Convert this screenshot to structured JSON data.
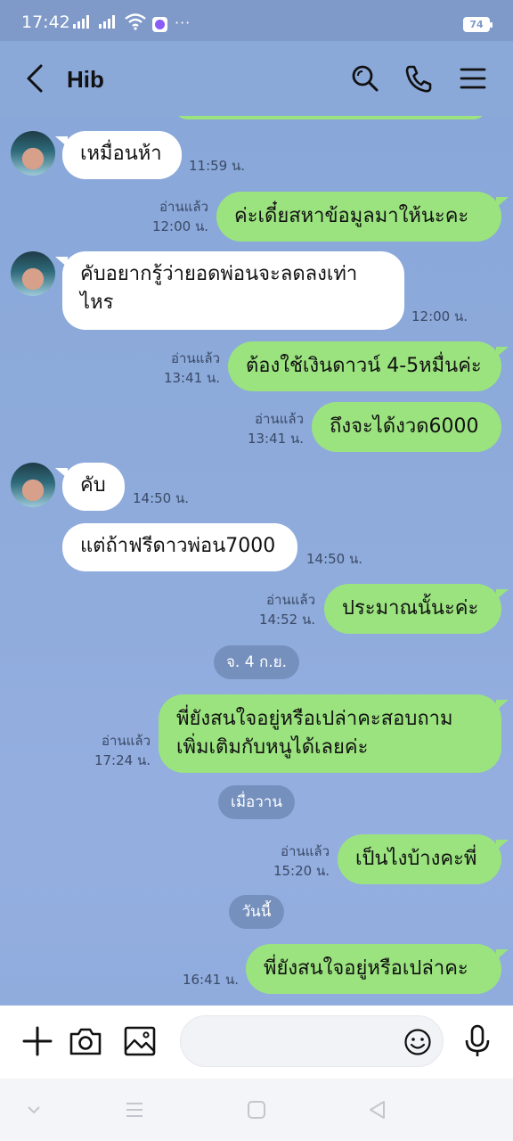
{
  "status": {
    "time": "17:42",
    "more": "···",
    "battery": "74"
  },
  "header": {
    "title": "Hib"
  },
  "messages": {
    "m1": {
      "text": "เหมื่อนห้า",
      "time": "11:59 น."
    },
    "m2": {
      "text": "ค่ะเดี๋ยสหาข้อมูลมาให้นะคะ",
      "read": "อ่านแล้ว",
      "time": "12:00 น."
    },
    "m3": {
      "line1": "คับอยากรู้ว่ายอดพ่อนจะลดลงเท่า",
      "line2": "ไหร",
      "time": "12:00 น."
    },
    "m4": {
      "text": "ต้องใช้เงินดาวน์ 4-5หมื่นค่ะ",
      "read": "อ่านแล้ว",
      "time": "13:41 น."
    },
    "m5": {
      "text": "ถึงจะได้งวด6000",
      "read": "อ่านแล้ว",
      "time": "13:41 น."
    },
    "m6": {
      "text": "คับ",
      "time": "14:50 น."
    },
    "m7": {
      "text": "แต่ถ้าฟรีดาวพ่อน7000",
      "time": "14:50 น."
    },
    "m8": {
      "text": "ประมาณนั้นะค่ะ",
      "read": "อ่านแล้ว",
      "time": "14:52 น."
    },
    "m9": {
      "line1": "พี่ยังสนใจอยู่หรือเปล่าคะสอบถาม",
      "line2": "เพิ่มเติมกับหนูได้เลยค่ะ",
      "read": "อ่านแล้ว",
      "time": "17:24 น."
    },
    "m10": {
      "text": "เป็นไงบ้างคะพี่",
      "read": "อ่านแล้ว",
      "time": "15:20 น."
    },
    "m11": {
      "text": "พี่ยังสนใจอยู่หรือเปล่าคะ",
      "time": "16:41 น."
    }
  },
  "dates": {
    "d1": "จ. 4 ก.ย.",
    "d2": "เมื่อวาน",
    "d3": "วันนี้"
  },
  "colors": {
    "chat_bg": "#8aa8d8",
    "outgoing_bubble": "#9be37f",
    "incoming_bubble": "#ffffff",
    "date_chip": "#7590bd"
  },
  "icons": [
    "back-arrow-icon",
    "search-icon",
    "phone-icon",
    "menu-icon",
    "plus-icon",
    "camera-icon",
    "image-icon",
    "emoji-icon",
    "microphone-icon"
  ]
}
